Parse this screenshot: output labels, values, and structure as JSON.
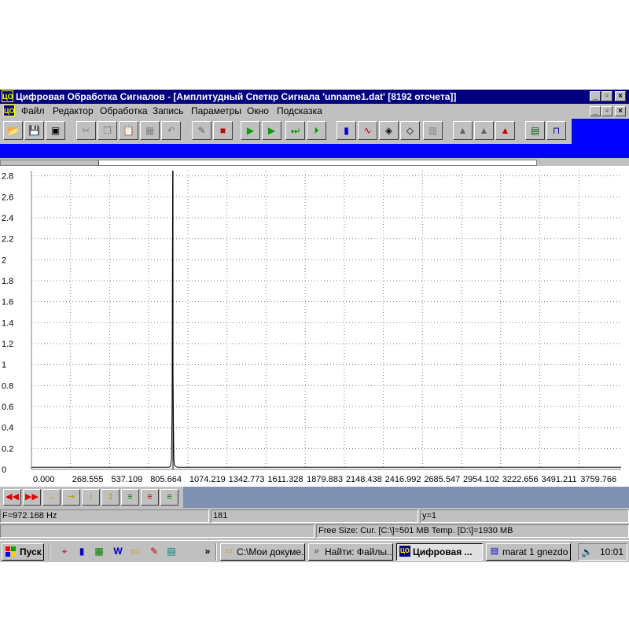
{
  "window": {
    "icon_label": "ЦО",
    "title": "Цифровая Обработка Сигналов - [Амплитудный Спеткр Сигнала 'unname1.dat' [8192 отсчета]]"
  },
  "menu": [
    "Файл",
    "Редактор",
    "Обработка",
    "Запись",
    "Параметры",
    "Окно",
    "Подсказка"
  ],
  "chart_data": {
    "type": "line",
    "y_ticks": [
      "2.8",
      "2.6",
      "2.4",
      "2.2",
      "2",
      "1.8",
      "1.6",
      "1.4",
      "1.2",
      "1",
      "0.8",
      "0.6",
      "0.4",
      "0.2",
      "0"
    ],
    "x_ticks": [
      "0.000",
      "268.555",
      "537.109",
      "805.664",
      "1074.219",
      "1342.773",
      "1611.328",
      "1879.883",
      "2148.438",
      "2416.992",
      "2685.547",
      "2954.102",
      "3222.656",
      "3491.211",
      "3759.766"
    ],
    "xlim": [
      0,
      4050
    ],
    "ylim": [
      0,
      2.85
    ],
    "grid": true,
    "series": [
      {
        "color": "#000000",
        "x": [
          0,
          900,
          945,
          955,
          962,
          966,
          970,
          972.168,
          974,
          978,
          982,
          990,
          1000,
          4050
        ],
        "y": [
          0.02,
          0.02,
          0.02,
          0.03,
          0.1,
          0.6,
          2.85,
          0.95,
          0.6,
          0.1,
          0.04,
          0.03,
          0.02,
          0.02
        ]
      }
    ],
    "cursor_x": 972.168
  },
  "status": {
    "frequency": "F=972.168 Hz",
    "index": "181",
    "y_value": "y=1",
    "free_size": "Free Size: Cur. [C:\\]=501 MB Temp. [D:\\]=1930 MB"
  },
  "taskbar": {
    "start": "Пуск",
    "tasks": [
      "C:\\Мои докуме...",
      "Найти: Файлы...",
      "Цифровая ...",
      "marat 1 gnezdo ..."
    ],
    "clock": "10:01",
    "chevron": "»"
  }
}
